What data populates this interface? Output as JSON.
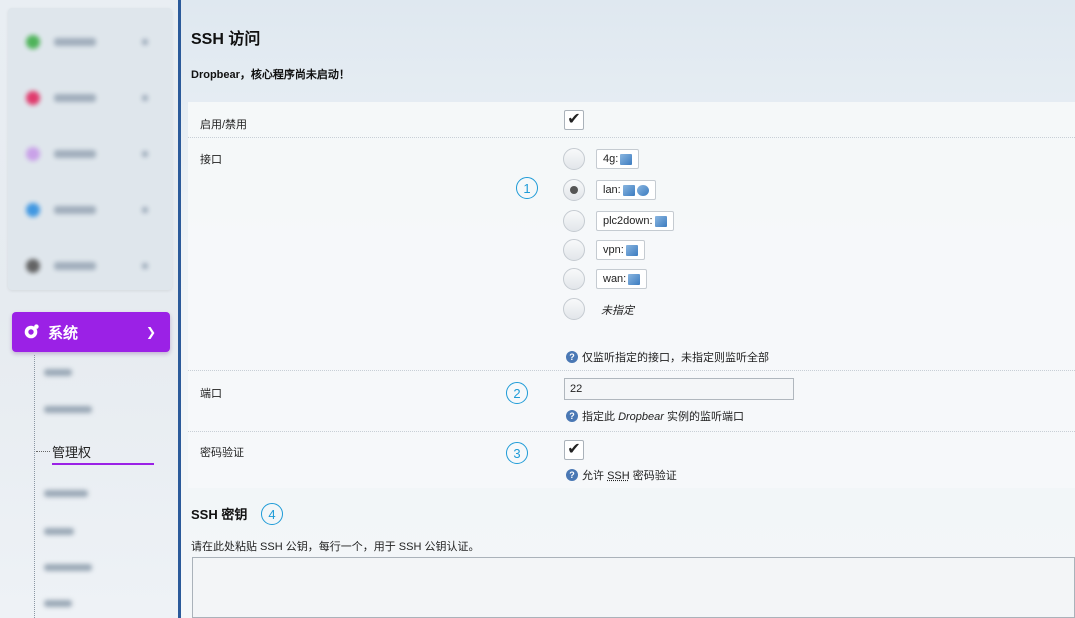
{
  "sidebar": {
    "system_label": "系统",
    "active_subitem": "管理权"
  },
  "page": {
    "title": "SSH 访问",
    "notice": "Dropbear，核心程序尚未启动！"
  },
  "form": {
    "enable_label": "启用/禁用",
    "enable_checked": true,
    "interface_label": "接口",
    "interfaces": [
      {
        "name": "4g:",
        "selected": false
      },
      {
        "name": "lan:",
        "selected": true
      },
      {
        "name": "plc2down:",
        "selected": false
      },
      {
        "name": "vpn:",
        "selected": false
      },
      {
        "name": "wan:",
        "selected": false
      }
    ],
    "unspecified_label": "未指定",
    "interface_help": "仅监听指定的接口，未指定则监听全部",
    "port_label": "端口",
    "port_value": "22",
    "port_help_pre": "指定此 ",
    "port_help_em": "Dropbear",
    "port_help_post": " 实例的监听端口",
    "password_label": "密码验证",
    "password_checked": true,
    "password_help_pre": "允许 ",
    "password_help_abbr": "SSH",
    "password_help_post": " 密码验证"
  },
  "ssh_keys": {
    "title": "SSH 密钥",
    "description": "请在此处粘贴 SSH 公钥，每行一个，用于 SSH 公钥认证。"
  },
  "markers": [
    "1",
    "2",
    "3",
    "4"
  ],
  "colors": {
    "accent": "#9b21e6",
    "marker": "#1e9bd7",
    "separator": "#2b5a9a"
  }
}
